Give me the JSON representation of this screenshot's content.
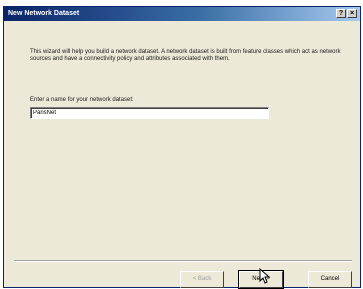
{
  "window": {
    "title": "New Network Dataset",
    "help_label": "?",
    "close_label": "×"
  },
  "body": {
    "intro_text": "This wizard will help you build a network dataset.  A network dataset is built from feature classes which act as network sources and have a connectivity policy and attributes associated with them.",
    "name_label": "Enter a name for your network dataset:",
    "name_value": "ParisNet"
  },
  "buttons": {
    "back_label": "< Back",
    "next_label": "Next >",
    "cancel_label": "Cancel"
  },
  "cursor_icon": "pointer-arrow-icon"
}
